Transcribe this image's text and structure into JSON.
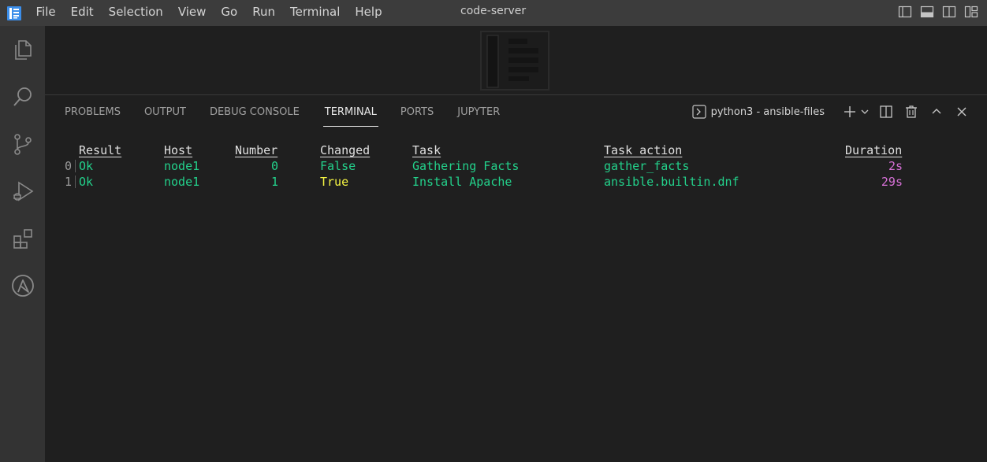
{
  "titlebar": {
    "title": "code-server",
    "menu": [
      "File",
      "Edit",
      "Selection",
      "View",
      "Go",
      "Run",
      "Terminal",
      "Help"
    ]
  },
  "activitybar": {
    "items": [
      "explorer-icon",
      "search-icon",
      "source-control-icon",
      "run-debug-icon",
      "extensions-icon",
      "ansible-icon"
    ]
  },
  "panel": {
    "tabs": [
      "PROBLEMS",
      "OUTPUT",
      "DEBUG CONSOLE",
      "TERMINAL",
      "PORTS",
      "JUPYTER"
    ],
    "active_tab": "TERMINAL",
    "terminal_name": "python3 - ansible-files"
  },
  "terminal": {
    "headers": [
      "Result",
      "Host",
      "Number",
      "Changed",
      "Task",
      "Task action",
      "Duration"
    ],
    "rows": [
      {
        "index": "0",
        "result": "Ok",
        "host": "node1",
        "number": "0",
        "changed": "False",
        "task": "Gathering Facts",
        "action": "gather_facts",
        "duration": "2s"
      },
      {
        "index": "1",
        "result": "Ok",
        "host": "node1",
        "number": "1",
        "changed": "True",
        "task": "Install Apache",
        "action": "ansible.builtin.dnf",
        "duration": "29s"
      }
    ]
  },
  "colors": {
    "green": "#23d18b",
    "yellow": "#f5f543",
    "magenta": "#d670d6",
    "logo_blue": "#3b8eea"
  }
}
